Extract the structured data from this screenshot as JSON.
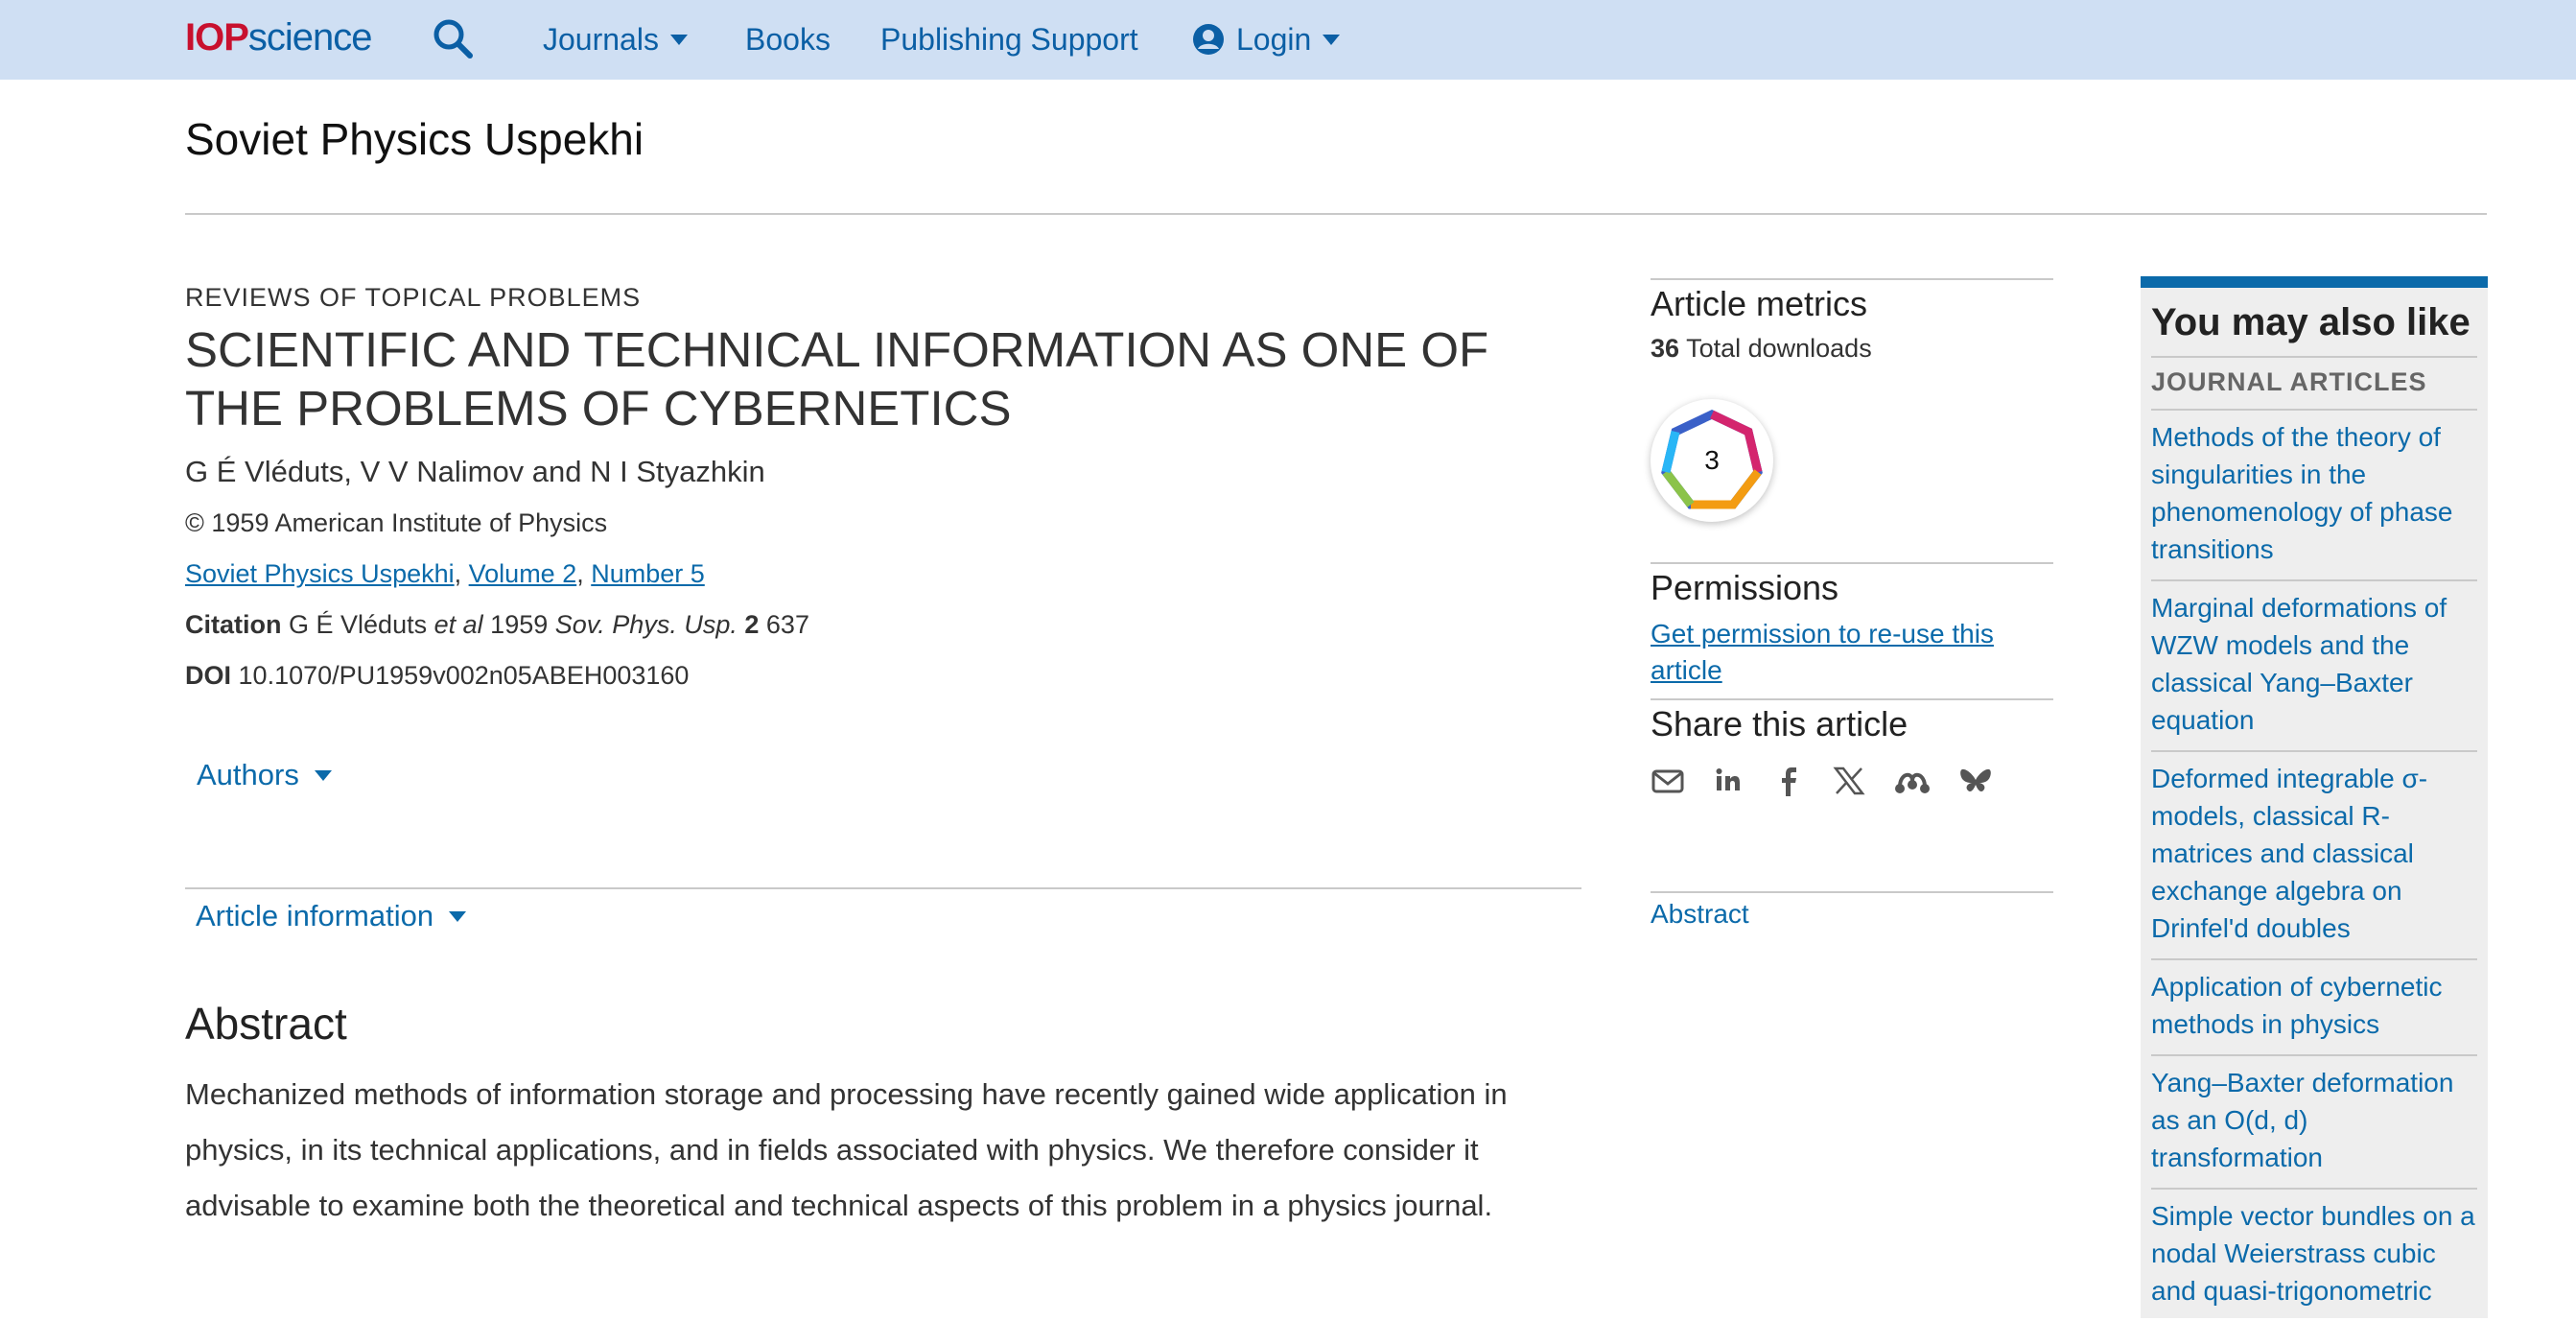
{
  "brand": {
    "logo_iop": "IOP",
    "logo_science": "science"
  },
  "nav": {
    "journals": "Journals",
    "books": "Books",
    "publishing_support": "Publishing Support",
    "login": "Login"
  },
  "journal": {
    "title": "Soviet Physics Uspekhi"
  },
  "article": {
    "section": "REVIEWS OF TOPICAL PROBLEMS",
    "title": "SCIENTIFIC AND TECHNICAL INFORMATION AS ONE OF THE PROBLEMS OF CYBERNETICS",
    "authors": "G É Vléduts, V V Nalimov and N I Styazhkin",
    "copyright": "© 1959 American Institute of Physics",
    "journal_link": "Soviet Physics Uspekhi",
    "volume_link": "Volume 2",
    "number_link": "Number 5",
    "citation_label": "Citation",
    "citation_author": "G É Vléduts",
    "citation_etal": "et al",
    "citation_year": "1959",
    "citation_journal": "Sov. Phys. Usp.",
    "citation_volume": "2",
    "citation_page": "637",
    "doi_label": "DOI",
    "doi_value": "10.1070/PU1959v002n05ABEH003160",
    "authors_toggle": "Authors",
    "info_toggle": "Article information",
    "abstract_heading": "Abstract",
    "abstract_text": "Mechanized methods of information storage and processing have recently gained wide application in physics, in its technical applications, and in fields associated with physics. We therefore consider it advisable to examine both the theoretical and technical aspects of this problem in a physics journal."
  },
  "metrics": {
    "heading": "Article metrics",
    "downloads_count": "36",
    "downloads_label": "Total downloads",
    "altmetric_score": "3"
  },
  "permissions": {
    "heading": "Permissions",
    "link": "Get permission to re-use this article"
  },
  "share": {
    "heading": "Share this article",
    "icons": [
      "email-icon",
      "linkedin-icon",
      "facebook-icon",
      "x-icon",
      "mendeley-icon",
      "bluesky-icon"
    ]
  },
  "toc": {
    "abstract_link": "Abstract"
  },
  "related": {
    "heading": "You may also like",
    "subheading": "JOURNAL ARTICLES",
    "items": [
      "Methods of the theory of singularities in the phenomenology of phase transitions",
      "Marginal deformations of WZW models and the classical Yang–Baxter equation",
      "Deformed integrable σ-models, classical R-matrices and classical exchange algebra on Drinfel'd doubles",
      "Application of cybernetic methods in physics",
      "Yang–Baxter deformation as an O(d, d) transformation",
      "Simple vector bundles on a nodal Weierstrass cubic and quasi-trigonometric"
    ]
  },
  "colors": {
    "accent": "#0b6aaa",
    "nav_bg": "#cfdff3",
    "logo_red": "#c8102e",
    "sidebar_bg": "#eeeeee"
  }
}
